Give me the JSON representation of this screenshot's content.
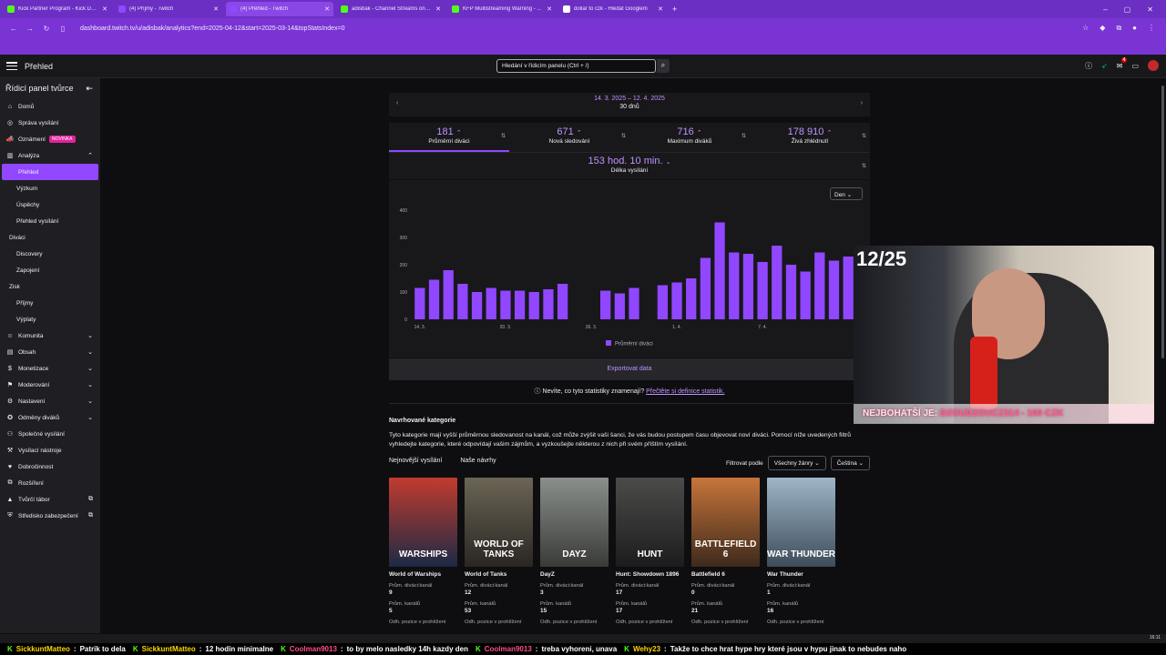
{
  "browser": {
    "tabs": [
      {
        "title": "Kick Partner Program - Kick Dashboard",
        "active": false,
        "color": "#53fc18"
      },
      {
        "title": "(4) Příjmy - Twitch",
        "active": false,
        "color": "#9147ff"
      },
      {
        "title": "(4) Přehled - Twitch",
        "active": true,
        "color": "#9147ff"
      },
      {
        "title": "adisbak - Channel Streams on Kick",
        "active": false,
        "color": "#53fc18"
      },
      {
        "title": "KFP Multistreaming Warning - ...",
        "active": false,
        "color": "#53fc18"
      },
      {
        "title": "dollar to czk - Hledat Googlem",
        "active": false,
        "color": "#ffffff"
      }
    ],
    "url": "dashboard.twitch.tv/u/adisbak/analytics?end=2025-04-12&start=2025-03-14&topStatsIndex=0"
  },
  "topnav": {
    "title": "Přehled",
    "search_placeholder": "Hledání v řídicím panelu (Ctrl + /)",
    "notif_count": "4"
  },
  "sidebar": {
    "header": "Řídicí panel tvůrce",
    "items": [
      {
        "label": "Domů",
        "icon": "home-icon",
        "level": 0
      },
      {
        "label": "Správa vysílání",
        "icon": "broadcast-icon",
        "level": 0
      },
      {
        "label": "Oznámení",
        "icon": "megaphone-icon",
        "level": 0,
        "badge": "NOVINKA"
      },
      {
        "label": "Analýza",
        "icon": "analytics-icon",
        "level": 0,
        "chevron": "up"
      },
      {
        "label": "Přehled",
        "level": 1,
        "active": true
      },
      {
        "label": "Výzkum",
        "level": 1
      },
      {
        "label": "Úspěchy",
        "level": 1
      },
      {
        "label": "Přehled vysílání",
        "level": 1
      },
      {
        "label": "Diváci",
        "level": 2
      },
      {
        "label": "Discovery",
        "level": 1
      },
      {
        "label": "Zapojení",
        "level": 1
      },
      {
        "label": "Zisk",
        "level": 2
      },
      {
        "label": "Příjmy",
        "level": 1
      },
      {
        "label": "Výplaty",
        "level": 1
      },
      {
        "label": "Komunita",
        "icon": "community-icon",
        "level": 0,
        "chevron": "down"
      },
      {
        "label": "Obsah",
        "icon": "content-icon",
        "level": 0,
        "chevron": "down"
      },
      {
        "label": "Monetizace",
        "icon": "monetization-icon",
        "level": 0,
        "chevron": "down"
      },
      {
        "label": "Moderování",
        "icon": "moderation-icon",
        "level": 0,
        "chevron": "down"
      },
      {
        "label": "Nastavení",
        "icon": "settings-icon",
        "level": 0,
        "chevron": "down"
      },
      {
        "label": "Odměny diváků",
        "icon": "rewards-icon",
        "level": 0,
        "chevron": "down"
      },
      {
        "label": "Společné vysílání",
        "icon": "collab-icon",
        "level": 0
      },
      {
        "label": "Vysílací nástroje",
        "icon": "tools-icon",
        "level": 0
      },
      {
        "label": "Dobročinnost",
        "icon": "charity-icon",
        "level": 0
      },
      {
        "label": "Rozšíření",
        "icon": "extensions-icon",
        "level": 0
      },
      {
        "label": "Tvůrčí tábor",
        "icon": "camp-icon",
        "level": 0,
        "external": true
      },
      {
        "label": "Středisko zabezpečení",
        "icon": "shield-icon",
        "level": 0,
        "external": true
      }
    ]
  },
  "daterange": {
    "range": "14. 3. 2025 – 12. 4. 2025",
    "days": "30 dnů"
  },
  "stats": [
    {
      "value": "181",
      "label": "Průměrní diváci",
      "selected": true
    },
    {
      "value": "671",
      "label": "Nová sledování"
    },
    {
      "value": "716",
      "label": "Maximum diváků"
    },
    {
      "value": "178 910",
      "label": "Živá zhlédnutí"
    }
  ],
  "stat_duration": {
    "value": "153 hod. 10 min.",
    "label": "Délka vysílání"
  },
  "chart_controls": {
    "granularity": "Den"
  },
  "chart_data": {
    "type": "bar",
    "title": "",
    "ylim": [
      0,
      400
    ],
    "yticks": [
      0,
      100,
      200,
      300,
      400
    ],
    "xticks": [
      "14. 3.",
      "20. 3.",
      "26. 3.",
      "1. 4.",
      "7. 4."
    ],
    "legend": "Průměrní diváci",
    "color": "#9147ff",
    "values": [
      115,
      145,
      180,
      130,
      100,
      115,
      105,
      105,
      100,
      110,
      130,
      0,
      0,
      105,
      95,
      115,
      0,
      125,
      135,
      150,
      225,
      355,
      245,
      240,
      210,
      270,
      200,
      175,
      245,
      215,
      230
    ]
  },
  "export_label": "Exportovat data",
  "help": {
    "text": "Nevíte, co tyto statistiky znamenají?",
    "link": "Přečtěte si definice statistik."
  },
  "categories": {
    "title": "Navrhované kategorie",
    "desc": "Tyto kategorie mají vyšší průměrnou sledovanost na kanál, což může zvýšit vaši šanci, že vás budou postupem času objevovat noví diváci. Pomocí níže uvedených filtrů vyhledejte kategorie, které odpovídají vašim zájmům, a vyzkoušejte některou z nich při svém příštím vysílání.",
    "tabs": [
      "Nejnovější vysílání",
      "Naše návrhy"
    ],
    "filter_label": "Filtrovat podle",
    "filter_genre": "Všechny žánry",
    "filter_lang": "Čeština",
    "k1": "Prům. diváci:kanál",
    "k2": "Prům. kanálů",
    "k3": "Odh. pozice v prohlížení",
    "games": [
      {
        "name": "World of Warships",
        "cover_text": "WARSHIPS",
        "viewers": "9",
        "channels": "5",
        "c1": "#c23b2e",
        "c2": "#1c2a45"
      },
      {
        "name": "World of Tanks",
        "cover_text": "WORLD OF TANKS",
        "viewers": "12",
        "channels": "53",
        "c1": "#6b6555",
        "c2": "#2a2622"
      },
      {
        "name": "DayZ",
        "cover_text": "DAYZ",
        "viewers": "3",
        "channels": "15",
        "c1": "#8a8f8c",
        "c2": "#3a3b38"
      },
      {
        "name": "Hunt: Showdown 1896",
        "cover_text": "HUNT",
        "viewers": "17",
        "channels": "17",
        "c1": "#4b4c4a",
        "c2": "#1c1c1c"
      },
      {
        "name": "Battlefield 6",
        "cover_text": "BATTLEFIELD 6",
        "viewers": "0",
        "channels": "21",
        "c1": "#c8753a",
        "c2": "#3e2a1c"
      },
      {
        "name": "War Thunder",
        "cover_text": "WAR THUNDER",
        "viewers": "1",
        "channels": "16",
        "c1": "#9fb6c8",
        "c2": "#3d4c5a"
      }
    ]
  },
  "overlay": {
    "counter": "12/25",
    "banner_label": "NEJBOHATŠÍ JE:",
    "banner_value": "DZOUDZOUCZ314 - 100 CZK"
  },
  "ticker": [
    {
      "user": "SickkuntMatteo",
      "msg": "Patrik to dela",
      "ucolor": "u1"
    },
    {
      "user": "SickkuntMatteo",
      "msg": "12 hodin minimalne",
      "ucolor": "u1"
    },
    {
      "user": "Coolman9013",
      "msg": "to by melo nasledky 14h kazdy den",
      "ucolor": "u2"
    },
    {
      "user": "Coolman9013",
      "msg": "treba vyhoreni, unava",
      "ucolor": "u2"
    },
    {
      "user": "Wehy23",
      "msg": "Takže to chce hrat hype hry které jsou v hypu jinak to nebudes naho",
      "ucolor": "u1"
    }
  ],
  "clock": "16:11"
}
